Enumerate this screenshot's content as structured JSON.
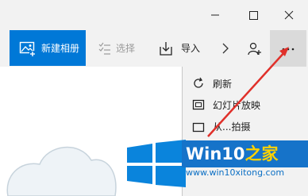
{
  "toolbar": {
    "new_album_label": "新建相册",
    "select_label": "选择",
    "import_label": "导入"
  },
  "menu": {
    "items": [
      {
        "label": "刷新"
      },
      {
        "label": "幻灯片放映"
      },
      {
        "label": "从...拍摄"
      }
    ]
  },
  "watermark": {
    "brand_text": "Win10",
    "brand_text_cn": "之家",
    "url": "www.win10xitong.com"
  },
  "colors": {
    "accent": "#0078d7",
    "arrow": "#e0302a",
    "logo_blue": "#0a84dc"
  }
}
